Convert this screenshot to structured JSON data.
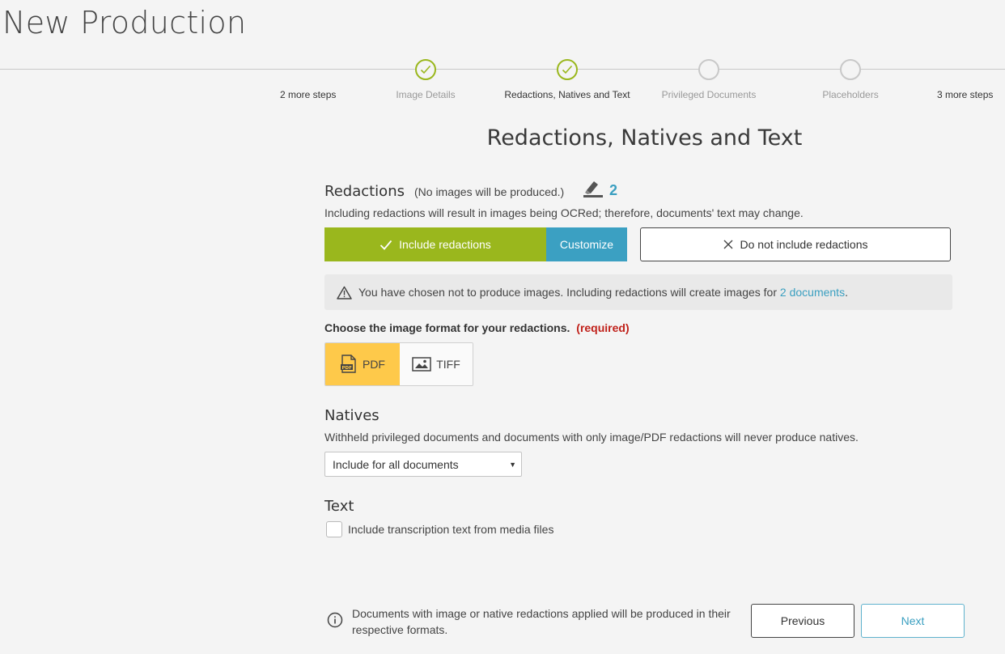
{
  "page": {
    "title": "New Production"
  },
  "stepper": {
    "more_before": "2 more steps",
    "more_after": "3 more steps",
    "steps": [
      {
        "label": "Image Details",
        "state": "done"
      },
      {
        "label": "Redactions, Natives and Text",
        "state": "current"
      },
      {
        "label": "Privileged Documents",
        "state": "todo"
      },
      {
        "label": "Placeholders",
        "state": "todo"
      }
    ]
  },
  "main": {
    "title": "Redactions, Natives and Text"
  },
  "redactions": {
    "heading": "Redactions",
    "note": "(No images will be produced.)",
    "icon": "highlighter-icon",
    "count": "2",
    "description": "Including redactions will result in images being OCRed; therefore, documents' text may change.",
    "include_label": "Include redactions",
    "customize_label": "Customize",
    "exclude_label": "Do not include redactions",
    "warning_text": "You have chosen not to produce images. Including redactions will create images for ",
    "warning_link": "2 documents",
    "warning_end": ".",
    "format_label": "Choose the image format for your redactions.",
    "format_required": "(required)",
    "formats": [
      {
        "label": "PDF",
        "selected": true,
        "icon": "pdf-file-icon"
      },
      {
        "label": "TIFF",
        "selected": false,
        "icon": "image-icon"
      }
    ]
  },
  "natives": {
    "heading": "Natives",
    "description": "Withheld privileged documents and documents with only image/PDF redactions will never produce natives.",
    "select_value": "Include for all documents"
  },
  "text": {
    "heading": "Text",
    "checkbox_label": "Include transcription text from media files",
    "checked": false
  },
  "footer": {
    "note": "Documents with image or native redactions applied will be produced in their respective formats.",
    "previous_label": "Previous",
    "next_label": "Next"
  },
  "colors": {
    "accent_green": "#9ab71d",
    "accent_blue": "#3ba0c2",
    "pdf_yellow": "#fec94a",
    "required_red": "#c0211a"
  }
}
